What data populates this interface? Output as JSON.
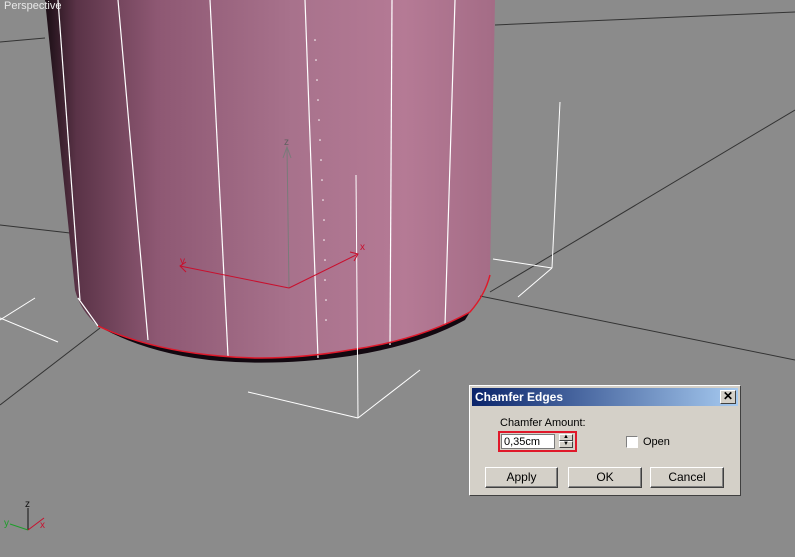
{
  "viewport": {
    "label": "Perspective",
    "colors": {
      "background": "#8b8b8b",
      "mesh": "#b57a95",
      "selection": "#e0182a",
      "wire": "#ffffff"
    },
    "gizmo": {
      "x": "x",
      "y": "y",
      "z": "z"
    },
    "world_axis": {
      "x": "x",
      "y": "y",
      "z": "z"
    }
  },
  "dialog": {
    "title": "Chamfer Edges",
    "close_icon": "close-icon",
    "amount_label": "Chamfer Amount:",
    "amount_value": "0,35cm",
    "open_label": "Open",
    "open_checked": false,
    "apply_label": "Apply",
    "ok_label": "OK",
    "cancel_label": "Cancel"
  }
}
